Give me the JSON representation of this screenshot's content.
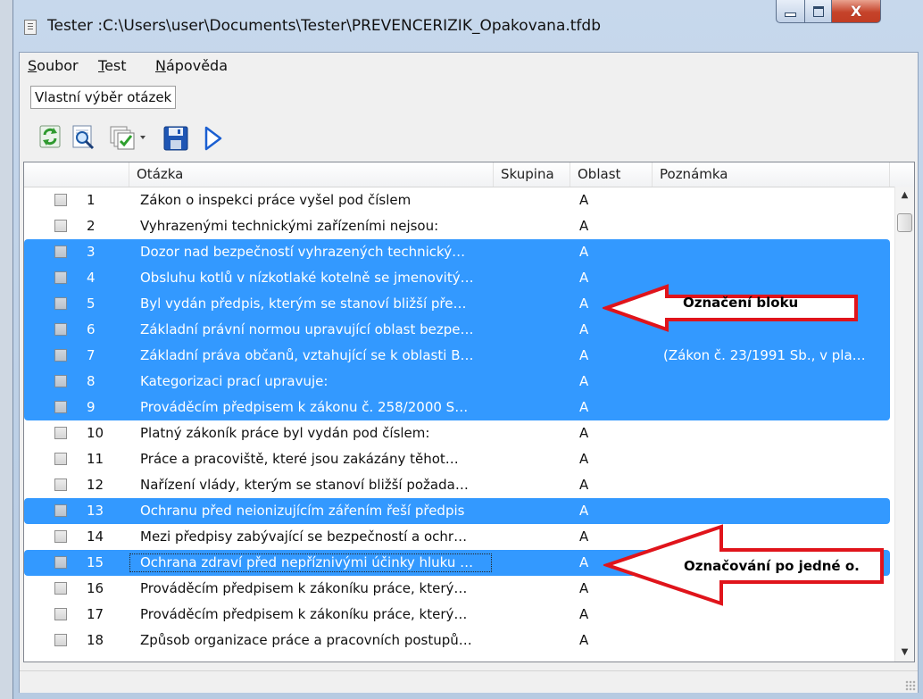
{
  "window": {
    "title": "Tester :C:\\Users\\user\\Documents\\Tester\\PREVENCERIZIK_Opakovana.tfdb",
    "close_glyph": "X"
  },
  "menu": [
    {
      "label_u": "S",
      "label_rest": "oubor"
    },
    {
      "label_u": "T",
      "label_rest": "est"
    },
    {
      "label_u": "N",
      "label_rest": "ápověda"
    }
  ],
  "selector": {
    "value": "Vlastní výběr otázek"
  },
  "toolbar": {
    "icons": [
      "refresh-icon",
      "preview-icon",
      "checklist-dropdown-icon",
      "save-icon",
      "run-icon"
    ]
  },
  "table": {
    "columns": [
      "Otázka",
      "Skupina",
      "Oblast",
      "Poznámka"
    ],
    "rows": [
      {
        "num": "1",
        "question": "Zákon o inspekci práce vyšel pod číslem",
        "area": "A",
        "note": "",
        "selected": false
      },
      {
        "num": "2",
        "question": "Vyhrazenými technickými zařízeními nejsou:",
        "area": "A",
        "note": "",
        "selected": false
      },
      {
        "num": "3",
        "question": "Dozor nad bezpečností vyhrazených technický…",
        "area": "A",
        "note": "",
        "selected": true
      },
      {
        "num": "4",
        "question": "Obsluhu kotlů v nízkotlaké kotelně se jmenovitý…",
        "area": "A",
        "note": "",
        "selected": true
      },
      {
        "num": "5",
        "question": "Byl vydán předpis, kterým se stanoví bližší pře…",
        "area": "A",
        "note": "",
        "selected": true
      },
      {
        "num": "6",
        "question": "Základní právní normou upravující oblast bezpe…",
        "area": "A",
        "note": "",
        "selected": true
      },
      {
        "num": "7",
        "question": "Základní práva občanů, vztahující se k oblasti B…",
        "area": "A",
        "note": "(Zákon č. 23/1991 Sb., v pla…",
        "selected": true
      },
      {
        "num": "8",
        "question": "Kategorizaci prací upravuje:",
        "area": "A",
        "note": "",
        "selected": true
      },
      {
        "num": "9",
        "question": "Prováděcím předpisem k zákonu č. 258/2000 S…",
        "area": "A",
        "note": "",
        "selected": true
      },
      {
        "num": "10",
        "question": "Platný zákoník práce byl vydán pod číslem:",
        "area": "A",
        "note": "",
        "selected": false
      },
      {
        "num": "11",
        "question": "Práce a pracoviště, které jsou zakázány těhot…",
        "area": "A",
        "note": "",
        "selected": false
      },
      {
        "num": "12",
        "question": "Nařízení vlády, kterým se stanoví bližší požada…",
        "area": "A",
        "note": "",
        "selected": false
      },
      {
        "num": "13",
        "question": "Ochranu před neionizujícím zářením řeší předpis",
        "area": "A",
        "note": "",
        "selected": true
      },
      {
        "num": "14",
        "question": "Mezi předpisy zabývající se bezpečností a ochr…",
        "area": "A",
        "note": "",
        "selected": false
      },
      {
        "num": "15",
        "question": "Ochrana zdraví před nepříznivými účinky hluku …",
        "area": "A",
        "note": "",
        "selected": true
      },
      {
        "num": "16",
        "question": "Prováděcím předpisem k zákoníku práce, který…",
        "area": "A",
        "note": "",
        "selected": false
      },
      {
        "num": "17",
        "question": "Prováděcím předpisem k zákoníku práce,  který…",
        "area": "A",
        "note": "",
        "selected": false
      },
      {
        "num": "18",
        "question": "Způsob organizace práce a pracovních postupů…",
        "area": "A",
        "note": "",
        "selected": false
      }
    ]
  },
  "annotations": {
    "block": "Označení bloku",
    "single": "Označování po jedné o.",
    "arrow_fill": "#ffffff",
    "arrow_stroke": "#e0141b"
  },
  "colors": {
    "selection": "#3399ff"
  }
}
